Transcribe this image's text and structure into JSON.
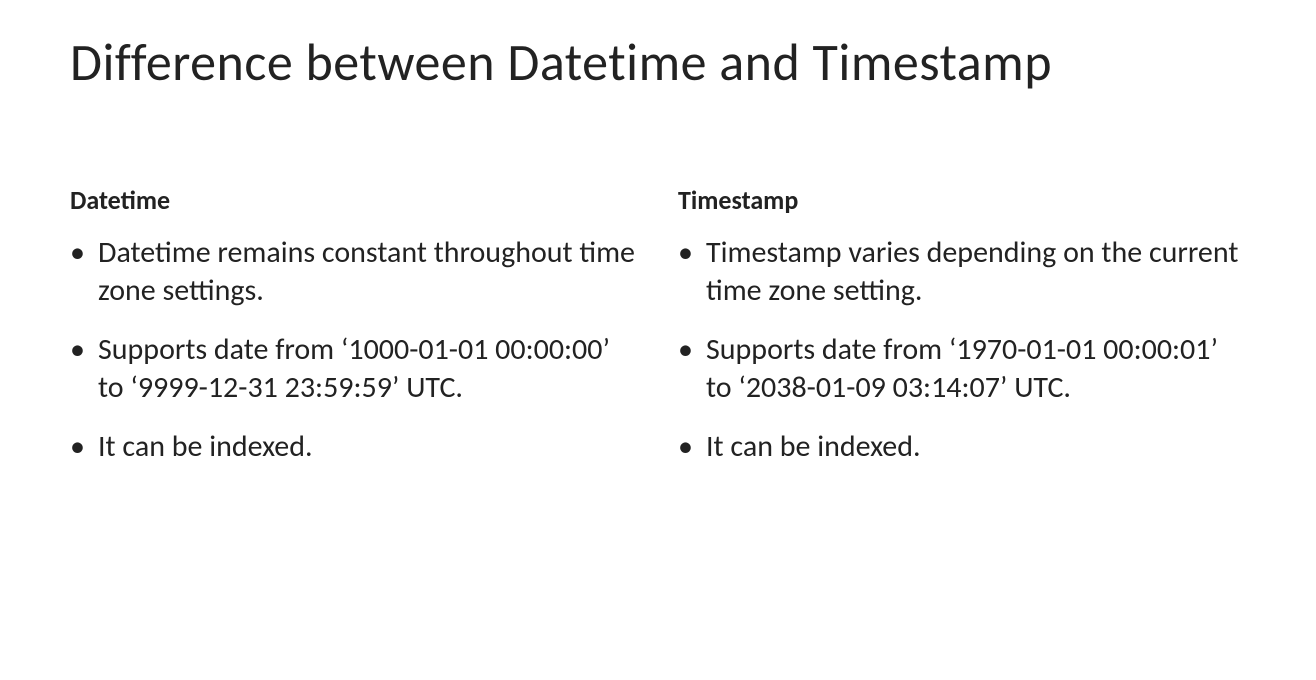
{
  "title": "Difference between Datetime and Timestamp",
  "columns": {
    "left": {
      "heading": "Datetime",
      "items": [
        "Datetime remains constant throughout time zone settings.",
        "Supports date from ‘1000-01-01 00:00:00’ to ‘9999-12-31 23:59:59’ UTC.",
        "It can be indexed."
      ]
    },
    "right": {
      "heading": "Timestamp",
      "items": [
        "Timestamp varies depending on the current time zone setting.",
        "Supports date from ‘1970-01-01 00:00:01’ to ‘2038-01-09 03:14:07’ UTC.",
        "It can be indexed."
      ]
    }
  }
}
